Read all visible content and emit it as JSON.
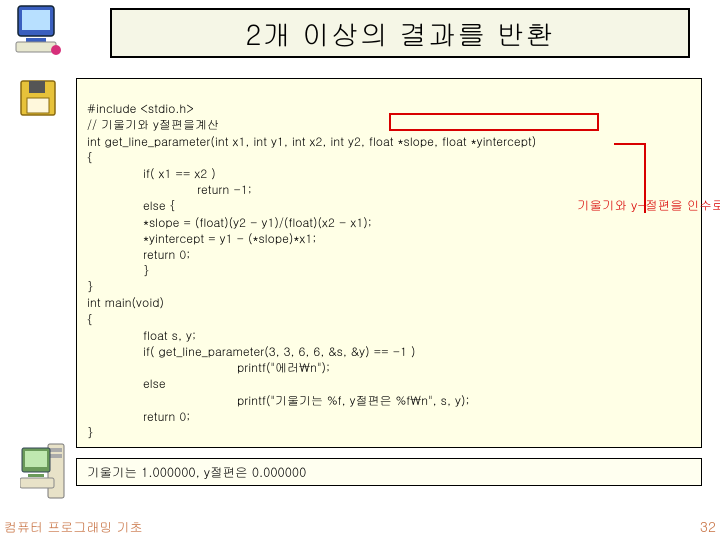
{
  "title": "2개 이상의 결과를 반환",
  "code": {
    "l1": "#include <stdio.h>",
    "l2": "// 기울기와 y절편을계산",
    "l3": "int get_line_parameter(int x1, int y1, int x2, int y2, float *slope, float *yintercept)",
    "l4": "{",
    "l5": "if( x1 == x2 )",
    "l6": "return -1;",
    "l7": "else {",
    "l8": "*slope = (float)(y2 - y1)/(float)(x2 - x1);",
    "l9": "*yintercept = y1 - (*slope)*x1;",
    "l10": "return 0;",
    "l11": "}",
    "l12": "}",
    "l13": "int main(void)",
    "l14": "{",
    "l15": "float s, y;",
    "l16": "if( get_line_parameter(3, 3, 6, 6, &s, &y) == -1 )",
    "l17": "printf(\"에러\\n\");",
    "l18": "else",
    "l19": "printf(\"기울기는 %f, y절편은 %f\\n\", s, y);",
    "l20": "return 0;",
    "l21": "}"
  },
  "annotation": "기울기와 y-절편을 인수로 전달",
  "output": "기울기는 1.000000, y절편은 0.000000",
  "footer": "컴퓨터 프로그래밍 기초",
  "page": "32",
  "colors": {
    "highlight": "#d80000",
    "codebg": "#ffffe6"
  }
}
